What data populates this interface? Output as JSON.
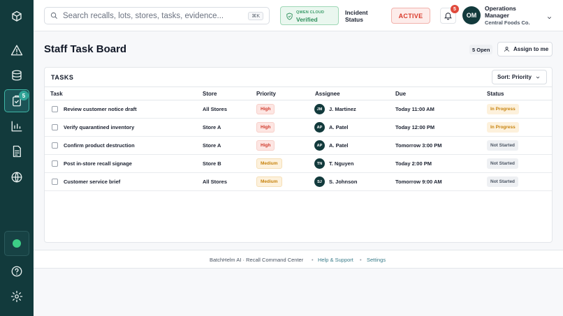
{
  "sidebar": {
    "tasks_badge": "5"
  },
  "header": {
    "search_placeholder": "Search recalls, lots, stores, tasks, evidence...",
    "search_shortcut": "⌘K",
    "cloud_label": "QWEN CLOUD",
    "cloud_status": "Verified",
    "incident_label": "Incident Status",
    "incident_value": "ACTIVE",
    "notification_count": "5",
    "user_initials": "OM",
    "user_role": "Operations Manager",
    "user_org": "Central Foods Co."
  },
  "page": {
    "title": "Staff Task Board",
    "open_count": "5 Open",
    "assign_label": "Assign to me"
  },
  "tasks": {
    "heading": "TASKS",
    "sort_label": "Sort: Priority",
    "columns": {
      "task": "Task",
      "store": "Store",
      "priority": "Priority",
      "assignee": "Assignee",
      "due": "Due",
      "status": "Status"
    },
    "rows": [
      {
        "task": "Review customer notice draft",
        "store": "All Stores",
        "priority": "High",
        "assignee_initials": "JM",
        "assignee": "J. Martinez",
        "due": "Today 11:00 AM",
        "status": "In Progress"
      },
      {
        "task": "Verify quarantined inventory",
        "store": "Store A",
        "priority": "High",
        "assignee_initials": "AP",
        "assignee": "A. Patel",
        "due": "Today 12:00 PM",
        "status": "In Progress"
      },
      {
        "task": "Confirm product destruction",
        "store": "Store A",
        "priority": "High",
        "assignee_initials": "AP",
        "assignee": "A. Patel",
        "due": "Tomorrow 3:00 PM",
        "status": "Not Started"
      },
      {
        "task": "Post in-store recall signage",
        "store": "Store B",
        "priority": "Medium",
        "assignee_initials": "TN",
        "assignee": "T. Nguyen",
        "due": "Today 2:00 PM",
        "status": "Not Started"
      },
      {
        "task": "Customer service brief",
        "store": "All Stores",
        "priority": "Medium",
        "assignee_initials": "SJ",
        "assignee": "S. Johnson",
        "due": "Tomorrow 9:00 AM",
        "status": "Not Started"
      }
    ]
  },
  "footer": {
    "brand": "BatchHelm AI · Recall Command Center",
    "help": "Help & Support",
    "settings": "Settings"
  },
  "colors": {
    "sidebar": "#123a3c",
    "accent": "#3fb6a6",
    "danger": "#d93a2b",
    "warning": "#c7830f",
    "success": "#2e8f5b"
  }
}
